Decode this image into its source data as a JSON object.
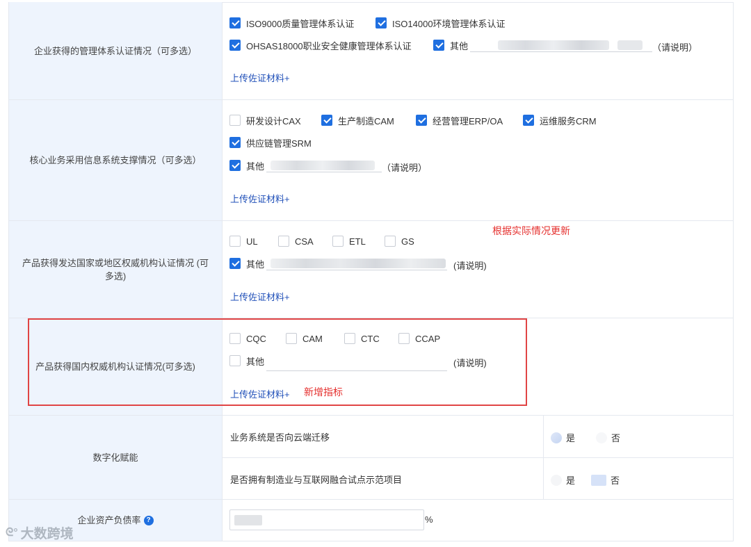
{
  "rows": {
    "mgmt": {
      "label": "企业获得的管理体系认证情况（可多选）",
      "options": [
        {
          "text": "ISO9000质量管理体系认证",
          "checked": true
        },
        {
          "text": "ISO14000环境管理体系认证",
          "checked": true
        },
        {
          "text": "OHSAS18000职业安全健康管理体系认证",
          "checked": true
        },
        {
          "text": "其他",
          "checked": true
        }
      ],
      "note": "（请说明）",
      "upload": "上传佐证材料+"
    },
    "core": {
      "label": "核心业务采用信息系统支撑情况（可多选）",
      "options": [
        {
          "text": "研发设计CAX",
          "checked": false
        },
        {
          "text": "生产制造CAM",
          "checked": true
        },
        {
          "text": "经营管理ERP/OA",
          "checked": true
        },
        {
          "text": "运维服务CRM",
          "checked": true
        },
        {
          "text": "供应链管理SRM",
          "checked": true
        },
        {
          "text": "其他",
          "checked": true
        }
      ],
      "note": "（请说明）",
      "upload": "上传佐证材料+"
    },
    "foreign": {
      "label": "产品获得发达国家或地区权威机构认证情况 (可多选)",
      "options": [
        {
          "text": "UL",
          "checked": false
        },
        {
          "text": "CSA",
          "checked": false
        },
        {
          "text": "ETL",
          "checked": false
        },
        {
          "text": "GS",
          "checked": false
        },
        {
          "text": "其他",
          "checked": true
        }
      ],
      "note": "(请说明)",
      "upload": "上传佐证材料+",
      "annotation": "根据实际情况更新"
    },
    "domestic": {
      "label": "产品获得国内权威机构认证情况(可多选)",
      "options": [
        {
          "text": "CQC",
          "checked": false
        },
        {
          "text": "CAM",
          "checked": false
        },
        {
          "text": "CTC",
          "checked": false
        },
        {
          "text": "CCAP",
          "checked": false
        },
        {
          "text": "其他",
          "checked": false
        }
      ],
      "note": "(请说明)",
      "upload": "上传佐证材料+",
      "annotation": "新增指标"
    },
    "digital": {
      "label": "数字化赋能",
      "questions": [
        {
          "text": "业务系统是否向云端迁移",
          "yes": "是",
          "no": "否"
        },
        {
          "text": "是否拥有制造业与互联网融合试点示范项目",
          "yes": "是",
          "no": "否"
        }
      ]
    },
    "debt": {
      "label": "企业资产负债率",
      "help": "?",
      "unit": "%"
    }
  },
  "watermark": "大数跨境",
  "colors": {
    "accent": "#1f6fe0",
    "label_bg": "#eef4fd",
    "annotation": "#e5302e"
  }
}
